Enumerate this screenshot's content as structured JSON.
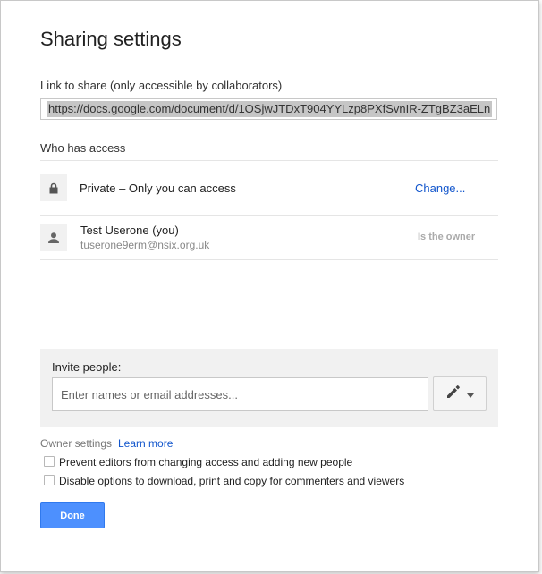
{
  "dialog": {
    "title": "Sharing settings"
  },
  "link": {
    "label": "Link to share (only accessible by collaborators)",
    "url": "https://docs.google.com/document/d/1OSjwJTDxT904YYLzp8PXfSvnIR-ZTgBZ3aELn"
  },
  "access": {
    "label": "Who has access",
    "visibility": {
      "icon": "lock-icon",
      "text": "Private – Only you can access",
      "change_label": "Change..."
    },
    "owner": {
      "icon": "person-icon",
      "name": "Test Userone (you)",
      "email": "tuserone9erm@nsix.org.uk",
      "role": "Is the owner"
    }
  },
  "invite": {
    "label": "Invite people:",
    "placeholder": "Enter names or email addresses...",
    "permission_icon": "pencil-icon",
    "dropdown_icon": "caret-down-icon"
  },
  "owner_settings": {
    "label": "Owner settings",
    "learn_more": "Learn more",
    "options": [
      {
        "label": "Prevent editors from changing access and adding new people",
        "checked": false
      },
      {
        "label": "Disable options to download, print and copy for commenters and viewers",
        "checked": false
      }
    ]
  },
  "actions": {
    "done_label": "Done"
  },
  "colors": {
    "link": "#1155cc",
    "primary_button": "#4d90fe",
    "panel_bg": "#f1f1f1"
  }
}
